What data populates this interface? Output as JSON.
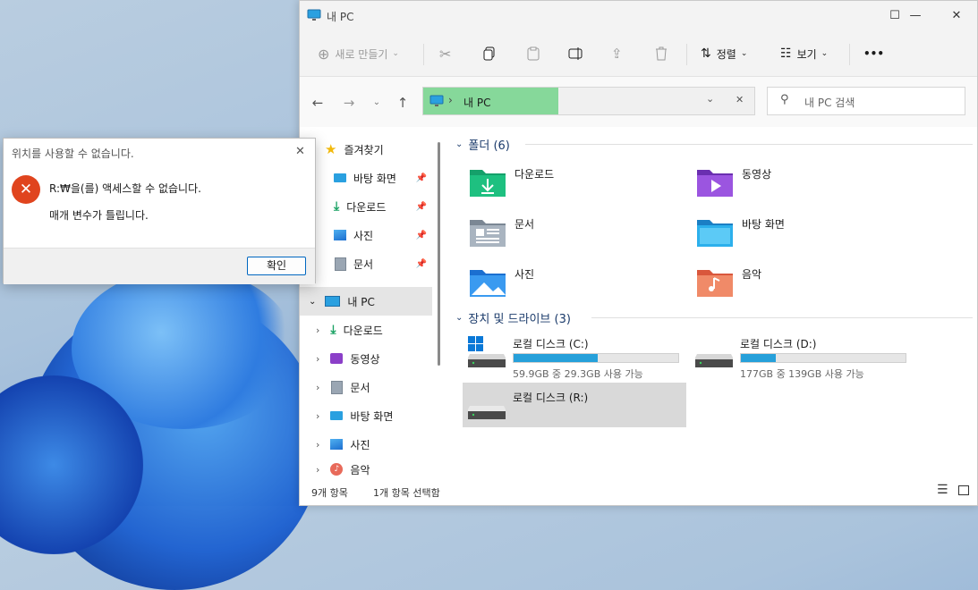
{
  "window": {
    "title": "내 PC",
    "controls": {
      "minimize": "—",
      "maximize": "☐",
      "close": "✕"
    }
  },
  "toolbar": {
    "new_label": "새로 만들기",
    "sort_label": "정렬",
    "view_label": "보기",
    "more_label": "•••"
  },
  "nav": {
    "address_path": "내 PC",
    "search_placeholder": "내 PC 검색"
  },
  "sidebar": {
    "quick_access": "즐겨찾기",
    "pinned": [
      {
        "label": "바탕 화면",
        "icon": "desktop-icon"
      },
      {
        "label": "다운로드",
        "icon": "download-icon"
      },
      {
        "label": "사진",
        "icon": "pictures-icon"
      },
      {
        "label": "문서",
        "icon": "documents-icon"
      }
    ],
    "this_pc": "내 PC",
    "pc_children": [
      {
        "label": "다운로드",
        "icon": "download-icon"
      },
      {
        "label": "동영상",
        "icon": "videos-icon"
      },
      {
        "label": "문서",
        "icon": "documents-icon"
      },
      {
        "label": "바탕 화면",
        "icon": "desktop-icon"
      },
      {
        "label": "사진",
        "icon": "pictures-icon"
      },
      {
        "label": "음악",
        "icon": "music-icon"
      }
    ]
  },
  "main": {
    "folders_header": "폴더 (6)",
    "folders": [
      {
        "label": "다운로드",
        "icon": "download-folder-icon"
      },
      {
        "label": "동영상",
        "icon": "videos-folder-icon"
      },
      {
        "label": "문서",
        "icon": "documents-folder-icon"
      },
      {
        "label": "바탕 화면",
        "icon": "desktop-folder-icon"
      },
      {
        "label": "사진",
        "icon": "pictures-folder-icon"
      },
      {
        "label": "음악",
        "icon": "music-folder-icon"
      }
    ],
    "drives_header": "장치 및 드라이브 (3)",
    "drives": [
      {
        "name": "로컬 디스크 (C:)",
        "free": "59.9GB 중 29.3GB 사용 가능",
        "used_fraction": 0.51
      },
      {
        "name": "로컬 디스크 (D:)",
        "free": "177GB 중 139GB 사용 가능",
        "used_fraction": 0.21
      },
      {
        "name": "로컬 디스크 (R:)",
        "free": "",
        "used_fraction": null
      }
    ]
  },
  "status": {
    "item_count": "9개 항목",
    "selected": "1개 항목 선택함"
  },
  "dialog": {
    "title": "위치를 사용할 수 없습니다.",
    "message1": "R:₩을(를) 액세스할 수 없습니다.",
    "message2": "매개 변수가 틀립니다.",
    "ok_label": "확인",
    "close": "✕"
  },
  "colors": {
    "accent": "#0067c0",
    "drive_bar": "#26a0da",
    "address_highlight": "#86d89a",
    "error_red": "#e0441e"
  }
}
